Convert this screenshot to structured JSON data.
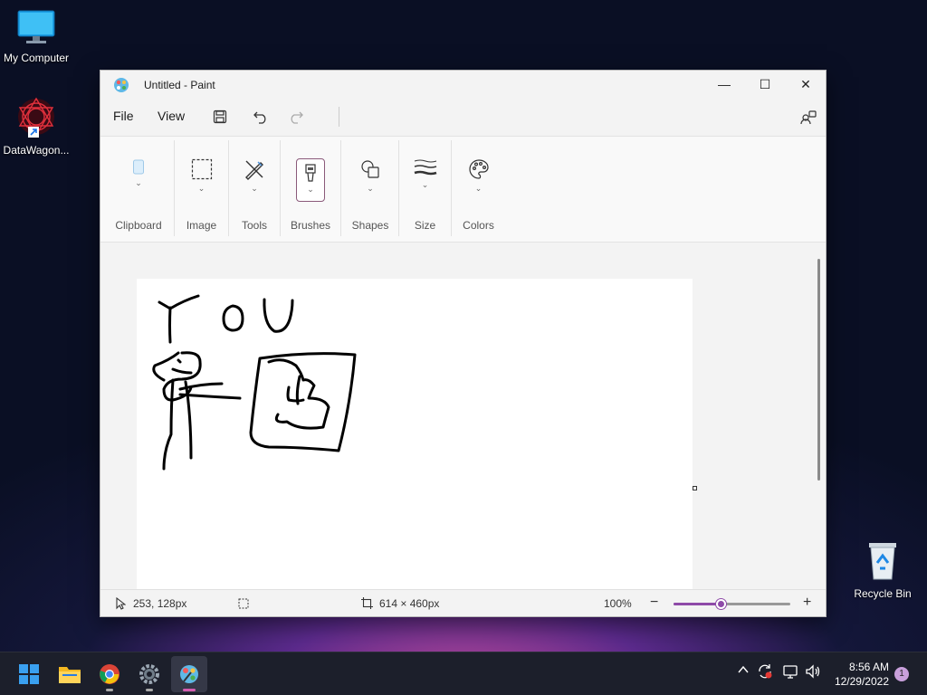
{
  "desktop": {
    "icons": [
      {
        "label": "My Computer"
      },
      {
        "label": "DataWagon..."
      },
      {
        "label": "Recycle Bin"
      }
    ]
  },
  "window": {
    "title": "Untitled - Paint",
    "controls": {
      "minimize": "—",
      "maximize": "☐",
      "close": "✕"
    }
  },
  "menu": {
    "file": "File",
    "view": "View"
  },
  "ribbon": {
    "groups": [
      {
        "label": "Clipboard"
      },
      {
        "label": "Image"
      },
      {
        "label": "Tools"
      },
      {
        "label": "Brushes"
      },
      {
        "label": "Shapes"
      },
      {
        "label": "Size"
      },
      {
        "label": "Colors"
      }
    ]
  },
  "status": {
    "cursor_pos": "253, 128px",
    "canvas_size": "614 × 460px",
    "zoom": "100%",
    "zoom_fraction": 0.4,
    "zoom_out": "−",
    "zoom_in": "+"
  },
  "taskbar": {
    "time": "8:56 AM",
    "date": "12/29/2022",
    "notifications": "1"
  },
  "colors": {
    "accent": "#8e4aa8",
    "taskbar": "#1c1f2b"
  }
}
